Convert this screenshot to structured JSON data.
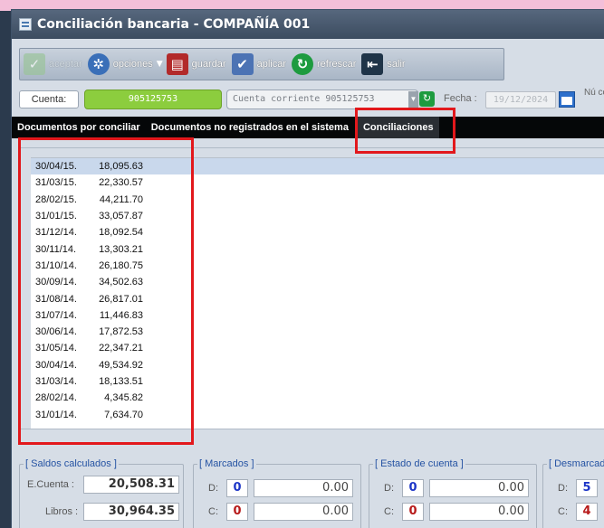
{
  "window": {
    "title": "Conciliación bancaria - COMPAÑÍA 001"
  },
  "toolbar": {
    "buttons": [
      {
        "label": "aceptar",
        "icon": "check-icon"
      },
      {
        "label": "opciones",
        "icon": "options-icon"
      },
      {
        "label": "guardar",
        "icon": "save-icon"
      },
      {
        "label": "aplicar",
        "icon": "apply-icon"
      },
      {
        "label": "refrescar",
        "icon": "refresh-icon"
      },
      {
        "label": "salir",
        "icon": "exit-icon"
      }
    ]
  },
  "account": {
    "label": "Cuenta:",
    "number": "905125753",
    "description": "Cuenta corriente 905125753",
    "date_label": "Fecha :",
    "date_value": "19/12/2024",
    "num_label": "Nú con"
  },
  "tabs": [
    {
      "label": "Documentos por conciliar"
    },
    {
      "label": "Documentos no registrados en el sistema"
    },
    {
      "label": "Conciliaciones"
    }
  ],
  "conciliaciones": [
    {
      "date": "30/04/15.",
      "amount": "18,095.63"
    },
    {
      "date": "31/03/15.",
      "amount": "22,330.57"
    },
    {
      "date": "28/02/15.",
      "amount": "44,211.70"
    },
    {
      "date": "31/01/15.",
      "amount": "33,057.87"
    },
    {
      "date": "31/12/14.",
      "amount": "18,092.54"
    },
    {
      "date": "30/11/14.",
      "amount": "13,303.21"
    },
    {
      "date": "31/10/14.",
      "amount": "26,180.75"
    },
    {
      "date": "30/09/14.",
      "amount": "34,502.63"
    },
    {
      "date": "31/08/14.",
      "amount": "26,817.01"
    },
    {
      "date": "31/07/14.",
      "amount": "11,446.83"
    },
    {
      "date": "30/06/14.",
      "amount": "17,872.53"
    },
    {
      "date": "31/05/14.",
      "amount": "22,347.21"
    },
    {
      "date": "30/04/14.",
      "amount": "49,534.92"
    },
    {
      "date": "31/03/14.",
      "amount": "18,133.51"
    },
    {
      "date": "28/02/14.",
      "amount": "4,345.82"
    },
    {
      "date": "31/01/14.",
      "amount": "7,634.70"
    }
  ],
  "saldos": {
    "title": "[ Saldos calculados ]",
    "ecuenta_label": "E.Cuenta :",
    "ecuenta_value": "20,508.31",
    "libros_label": "Libros :",
    "libros_value": "30,964.35"
  },
  "marcados": {
    "title": "[ Marcados ]",
    "d_label": "D:",
    "d_count": "0",
    "d_amount": "0.00",
    "c_label": "C:",
    "c_count": "0",
    "c_amount": "0.00"
  },
  "estado": {
    "title": "[ Estado de cuenta ]",
    "d_label": "D:",
    "d_count": "0",
    "d_amount": "0.00",
    "c_label": "C:",
    "c_count": "0",
    "c_amount": "0.00"
  },
  "desmarcados": {
    "title": "[ Desmarcad",
    "d_label": "D:",
    "d_count": "5",
    "c_label": "C:",
    "c_count": "4"
  },
  "colors": {
    "accent_green": "#8ccd3e",
    "highlight_red": "#e2181c",
    "tab_bar": "#050708"
  }
}
